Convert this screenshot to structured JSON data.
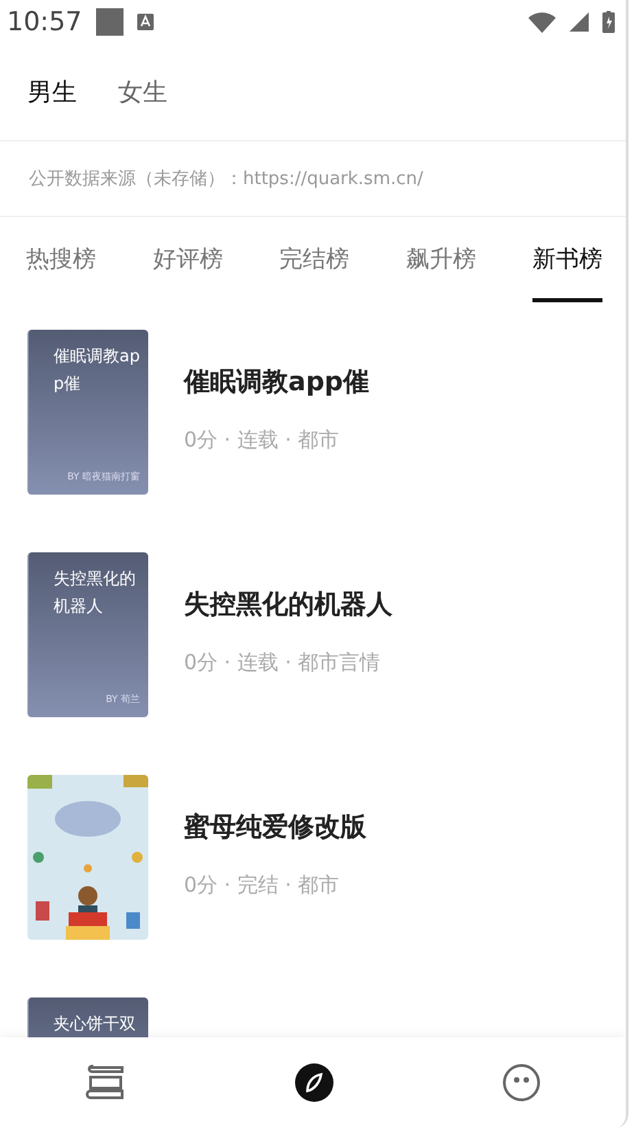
{
  "status_bar": {
    "time": "10:57"
  },
  "gender_tabs": [
    {
      "label": "男生",
      "selected": true
    },
    {
      "label": "女生",
      "selected": false
    }
  ],
  "source_note": "公开数据来源（未存储）：https://quark.sm.cn/",
  "rank_tabs": [
    {
      "label": "热搜榜",
      "selected": false
    },
    {
      "label": "好评榜",
      "selected": false
    },
    {
      "label": "完结榜",
      "selected": false
    },
    {
      "label": "飙升榜",
      "selected": false
    },
    {
      "label": "新书榜",
      "selected": true
    }
  ],
  "books": [
    {
      "cover": {
        "kind": "text",
        "title": "催眠调教app催",
        "author": "BY 暗夜猫南打窗"
      },
      "title": "催眠调教app催",
      "meta": "0分 · 连载 · 都市"
    },
    {
      "cover": {
        "kind": "text",
        "title": "失控黑化的机器人",
        "author": "BY 荀兰"
      },
      "title": "失控黑化的机器人",
      "meta": "0分 · 连载 · 都市言情"
    },
    {
      "title": "蜜母纯爱修改版",
      "meta": "0分 · 完结 · 都市"
    },
    {
      "cover": {
        "kind": "text",
        "title": "夹心饼干双"
      }
    }
  ],
  "bottom_nav": [
    {
      "kind": "shelf",
      "selected": false
    },
    {
      "kind": "discover",
      "selected": true
    },
    {
      "kind": "profile",
      "selected": false
    }
  ]
}
